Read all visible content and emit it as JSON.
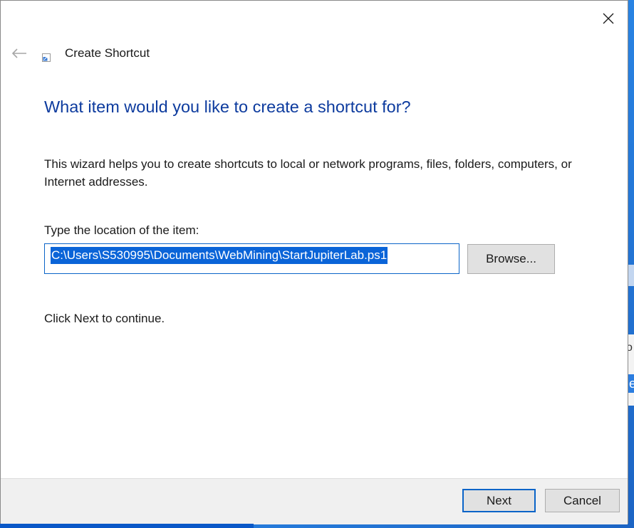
{
  "window": {
    "title": "Create Shortcut"
  },
  "page": {
    "heading": "What item would you like to create a shortcut for?",
    "description": "This wizard helps you to create shortcuts to local or network programs, files, folders, computers, or Internet addresses.",
    "location_label": "Type the location of the item:",
    "location_value": "C:\\Users\\S530995\\Documents\\WebMining\\StartJupiterLab.ps1",
    "continue_text": "Click Next to continue."
  },
  "buttons": {
    "browse": "Browse...",
    "next": "Next",
    "cancel": "Cancel"
  },
  "background": {
    "glyph": "o",
    "blue_glyph": "e"
  },
  "icons": {
    "close": "close-icon",
    "back": "back-arrow-icon",
    "shortcut": "shortcut-icon"
  },
  "colors": {
    "heading": "#0d3b9e",
    "selection": "#0a64d8",
    "focus_border": "#0a64c8",
    "desktop": "#1e6fd0"
  }
}
